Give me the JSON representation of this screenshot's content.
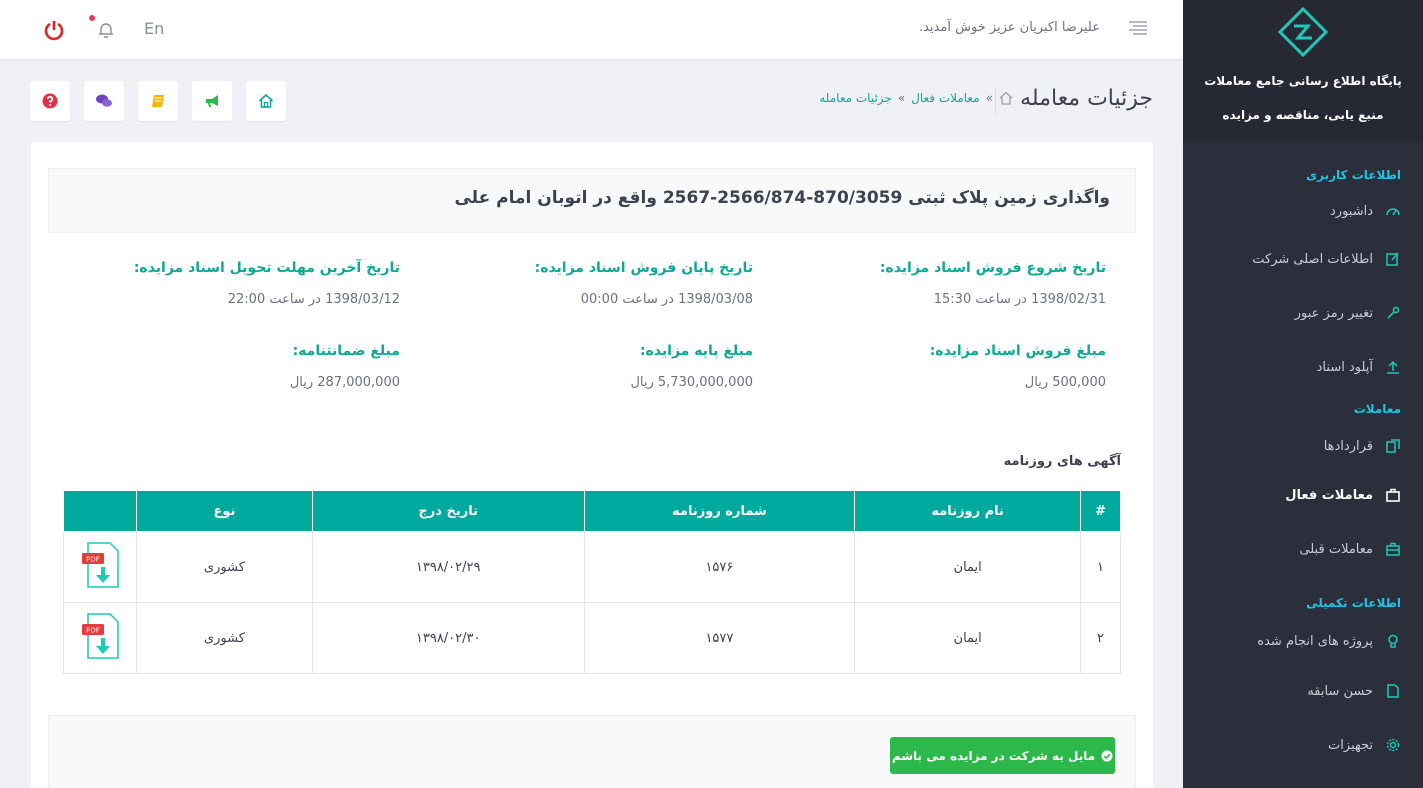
{
  "sidebar": {
    "brand_line1": "پایگاه اطلاع رسانی جامع معاملات",
    "brand_line2": "منبع یابی، مناقصه و مزایده",
    "sections": [
      {
        "title": "اطلاعات کاربری",
        "items": [
          {
            "label": "داشبورد",
            "icon": "dashboard-icon"
          },
          {
            "label": "اطلاعات اصلی شرکت",
            "icon": "edit-icon"
          },
          {
            "label": "تغییر رمز عبور",
            "icon": "key-icon"
          },
          {
            "label": "آپلود اسناد",
            "icon": "upload-icon"
          }
        ]
      },
      {
        "title": "معاملات",
        "items": [
          {
            "label": "قراردادها",
            "icon": "contracts-icon"
          },
          {
            "label": "معاملات فعال",
            "icon": "briefcase-icon"
          },
          {
            "label": "معاملات قبلی",
            "icon": "archive-icon"
          }
        ]
      },
      {
        "title": "اطلاعات تکمیلی",
        "items": [
          {
            "label": "پروژه های انجام شده",
            "icon": "lightbulb-icon"
          },
          {
            "label": "حسن سابقه",
            "icon": "document-icon"
          },
          {
            "label": "تجهیزات",
            "icon": "gear-icon"
          }
        ]
      }
    ]
  },
  "topbar": {
    "welcome": "علیرضا اکبریان عزیز خوش آمدید.",
    "lang": "En"
  },
  "header": {
    "title": "جزئیات معامله",
    "breadcrumb": [
      "معاملات فعال",
      "جزئیات معامله"
    ],
    "breadcrumb_sep": "»"
  },
  "deal": {
    "title": "واگذاری زمین پلاک ثبتی 870/3059-2566/874-2567 واقع در اتوبان امام علی",
    "fields": [
      {
        "label": "تاریخ شروع فروش اسناد مزایده:",
        "value": "1398/02/31 در ساعت 15:30"
      },
      {
        "label": "تاریخ پایان فروش اسناد مزایده:",
        "value": "1398/03/08 در ساعت 00:00"
      },
      {
        "label": "تاریخ آخرین مهلت تحویل اسناد مزایده:",
        "value": "1398/03/12 در ساعت 22:00"
      },
      {
        "label": "مبلغ فروش اسناد مزایده:",
        "value": "500,000 ریال"
      },
      {
        "label": "مبلغ پایه مزایده:",
        "value": "5,730,000,000 ریال"
      },
      {
        "label": "مبلغ ضمانتنامه:",
        "value": "287,000,000 ریال"
      }
    ]
  },
  "ads": {
    "title": "آگهی های روزنامه",
    "columns": [
      "#",
      "نام روزنامه",
      "شماره روزنامه",
      "تاریخ درج",
      "نوع",
      ""
    ],
    "rows": [
      {
        "idx": "۱",
        "paper": "ایمان",
        "number": "۱۵۷۶",
        "date": "۱۳۹۸/۰۲/۲۹",
        "type": "کشوری",
        "file": "PDF"
      },
      {
        "idx": "۲",
        "paper": "ایمان",
        "number": "۱۵۷۷",
        "date": "۱۳۹۸/۰۲/۳۰",
        "type": "کشوری",
        "file": "PDF"
      }
    ]
  },
  "cta": {
    "label": "مایل به شرکت در مزایده می باشم"
  },
  "colors": {
    "accent": "#10a795",
    "table_header": "#00a99d",
    "sidebar": "#2b2e3b",
    "cta": "#2db84c",
    "section": "#22c3e6"
  }
}
